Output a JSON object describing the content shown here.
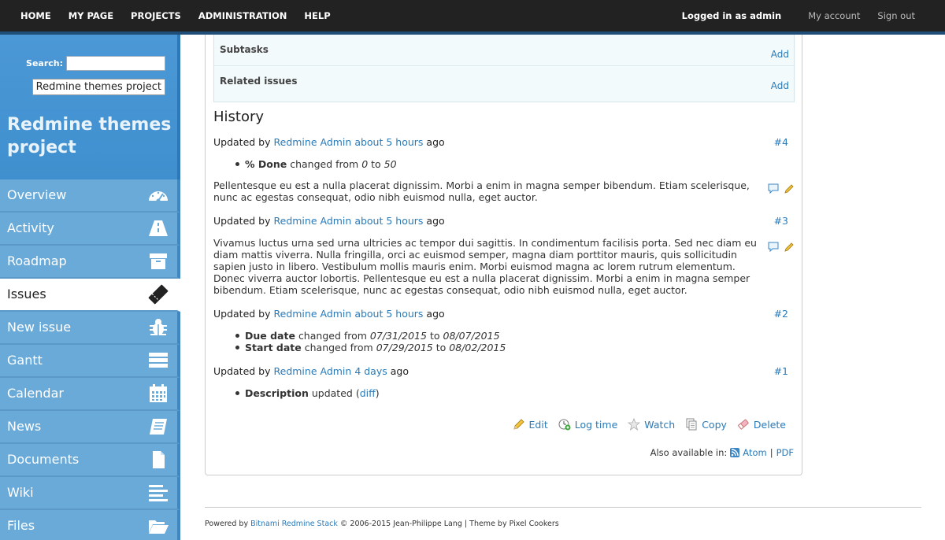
{
  "topbar": {
    "nav": [
      "HOME",
      "MY PAGE",
      "PROJECTS",
      "ADMINISTRATION",
      "HELP"
    ],
    "logged_in": "Logged in as admin",
    "my_account": "My account",
    "sign_out": "Sign out"
  },
  "sidebar": {
    "search_label": "Search:",
    "project_select": "Redmine themes project",
    "project_title_line1": "Redmine themes",
    "project_title_line2": "project",
    "menu": [
      {
        "label": "Overview",
        "icon": "dashboard-icon"
      },
      {
        "label": "Activity",
        "icon": "road-icon"
      },
      {
        "label": "Roadmap",
        "icon": "archive-box-icon"
      },
      {
        "label": "Issues",
        "icon": "ticket-icon",
        "active": true
      },
      {
        "label": "New issue",
        "icon": "bug-icon"
      },
      {
        "label": "Gantt",
        "icon": "gantt-bars-icon"
      },
      {
        "label": "Calendar",
        "icon": "calendar-icon"
      },
      {
        "label": "News",
        "icon": "newspaper-icon"
      },
      {
        "label": "Documents",
        "icon": "document-icon"
      },
      {
        "label": "Wiki",
        "icon": "align-left-icon"
      },
      {
        "label": "Files",
        "icon": "folder-open-icon"
      }
    ]
  },
  "relations": {
    "subtasks": "Subtasks",
    "related": "Related issues",
    "add": "Add"
  },
  "history": {
    "title": "History",
    "updated_by": "Updated by",
    "ago": "ago",
    "journals": [
      {
        "author": "Redmine Admin",
        "time": "about 5 hours",
        "num": "#4",
        "details": [
          {
            "field": "% Done",
            "changed_from": "changed from",
            "old": "0",
            "to": "to",
            "new": "50"
          }
        ],
        "note": "Pellentesque eu est a nulla placerat dignissim. Morbi a enim in magna semper bibendum. Etiam scelerisque, nunc ac egestas consequat, odio nibh euismod nulla, eget auctor."
      },
      {
        "author": "Redmine Admin",
        "time": "about 5 hours",
        "num": "#3",
        "note": "Vivamus luctus urna sed urna ultricies ac tempor dui sagittis. In condimentum facilisis porta. Sed nec diam eu diam mattis viverra. Nulla fringilla, orci ac euismod semper, magna diam porttitor mauris, quis sollicitudin sapien justo in libero. Vestibulum mollis mauris enim. Morbi euismod magna ac lorem rutrum elementum. Donec viverra auctor lobortis. Pellentesque eu est a nulla placerat dignissim. Morbi a enim in magna semper bibendum. Etiam scelerisque, nunc ac egestas consequat, odio nibh euismod nulla, eget auctor."
      },
      {
        "author": "Redmine Admin",
        "time": "about 5 hours",
        "num": "#2",
        "details": [
          {
            "field": "Due date",
            "changed_from": "changed from",
            "old": "07/31/2015",
            "to": "to",
            "new": "08/07/2015"
          },
          {
            "field": "Start date",
            "changed_from": "changed from",
            "old": "07/29/2015",
            "to": "to",
            "new": "08/02/2015"
          }
        ]
      },
      {
        "author": "Redmine Admin",
        "time": "4 days",
        "num": "#1",
        "details": [
          {
            "field": "Description",
            "updated": "updated",
            "diff": "diff"
          }
        ]
      }
    ]
  },
  "actions": {
    "edit": "Edit",
    "log_time": "Log time",
    "watch": "Watch",
    "copy": "Copy",
    "delete": "Delete"
  },
  "also_available": {
    "label": "Also available in:",
    "atom": "Atom",
    "pdf": "PDF",
    "sep": "|"
  },
  "footer": {
    "powered_by": "Powered by",
    "link": "Bitnami Redmine Stack",
    "rest": "© 2006-2015 Jean-Philippe Lang | Theme by Pixel Cookers"
  }
}
